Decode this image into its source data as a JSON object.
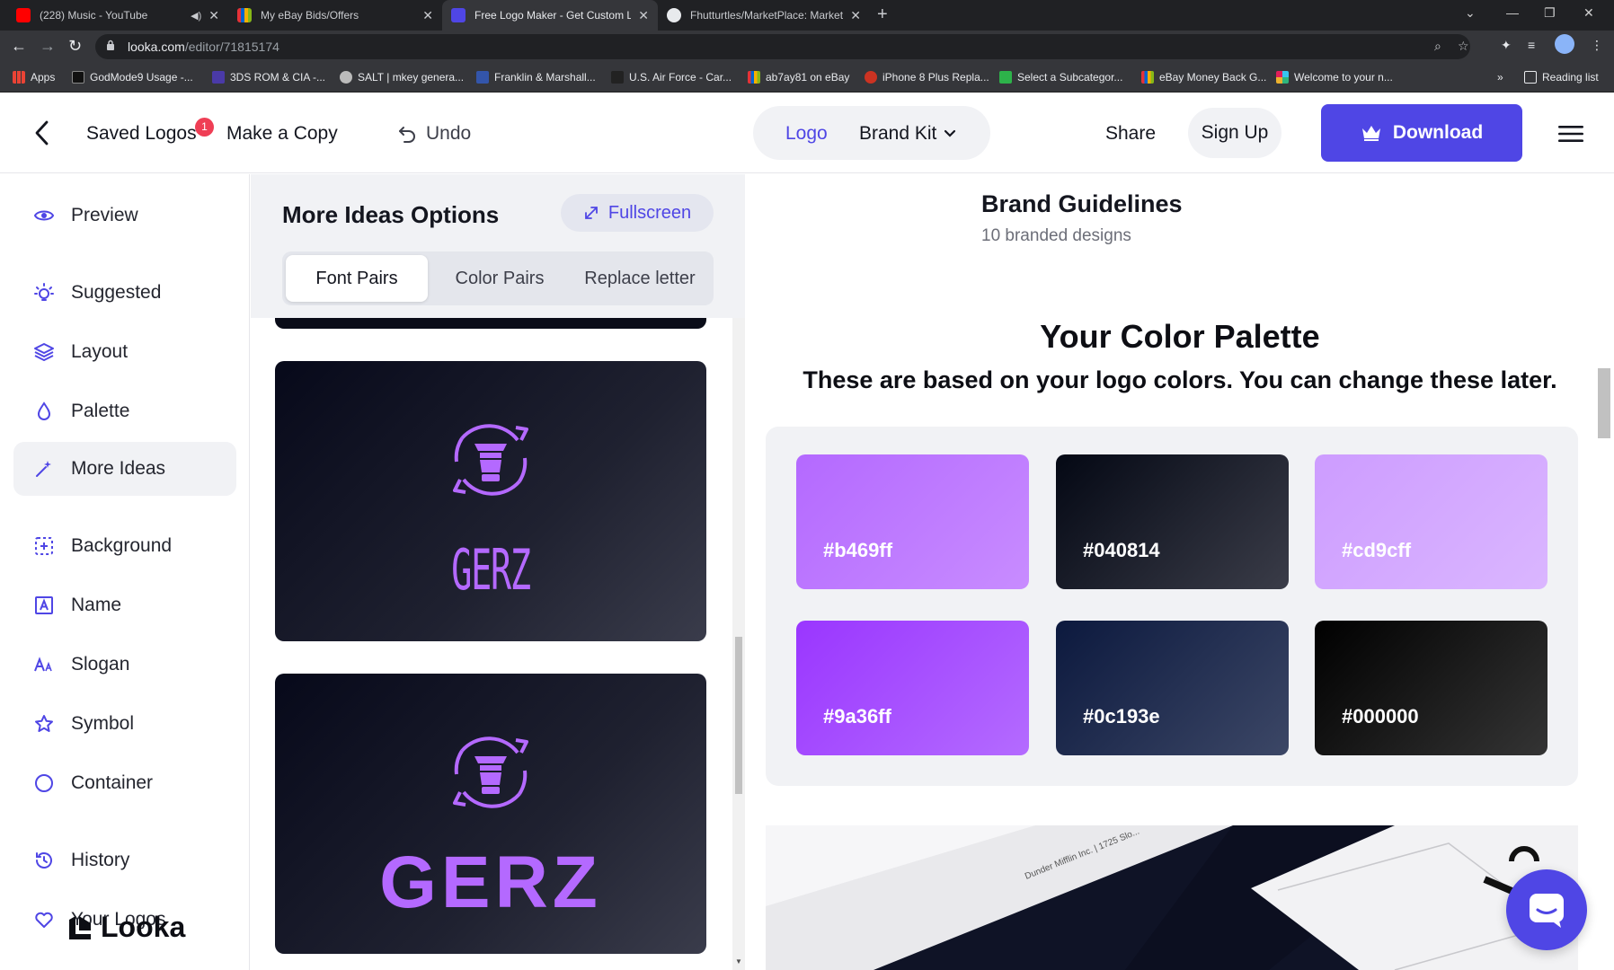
{
  "browser": {
    "tabs": [
      {
        "title": "(228) Music - YouTube",
        "active": false
      },
      {
        "title": "My eBay Bids/Offers",
        "active": false
      },
      {
        "title": "Free Logo Maker - Get Custom L",
        "active": true
      },
      {
        "title": "Fhutturtles/MarketPlace: Market",
        "active": false
      }
    ],
    "url_host": "looka.com",
    "url_path": "/editor/71815174",
    "bookmarks": [
      "Apps",
      "GodMode9 Usage -...",
      "3DS ROM & CIA -...",
      "SALT | mkey genera...",
      "Franklin & Marshall...",
      "U.S. Air Force - Car...",
      "ab7ay81 on eBay",
      "iPhone 8 Plus Repla...",
      "Select a Subcategor...",
      "eBay Money Back G...",
      "Welcome to your n..."
    ],
    "reading_list": "Reading list"
  },
  "header": {
    "saved_logos": "Saved Logos",
    "saved_badge": "1",
    "make_copy": "Make a Copy",
    "undo": "Undo",
    "logo_tab": "Logo",
    "brand_kit": "Brand Kit",
    "share": "Share",
    "sign_up": "Sign Up",
    "download": "Download"
  },
  "sidebar": {
    "items": [
      {
        "label": "Preview",
        "icon": "eye-icon"
      },
      {
        "label": "Suggested",
        "icon": "lightbulb-icon"
      },
      {
        "label": "Layout",
        "icon": "layers-icon"
      },
      {
        "label": "Palette",
        "icon": "droplet-icon"
      },
      {
        "label": "More Ideas",
        "icon": "magic-wand-icon"
      },
      {
        "label": "Background",
        "icon": "background-icon"
      },
      {
        "label": "Name",
        "icon": "name-icon"
      },
      {
        "label": "Slogan",
        "icon": "slogan-icon"
      },
      {
        "label": "Symbol",
        "icon": "star-icon"
      },
      {
        "label": "Container",
        "icon": "circle-icon"
      },
      {
        "label": "History",
        "icon": "history-icon"
      },
      {
        "label": "Your Logos",
        "icon": "heart-icon"
      }
    ],
    "brand": "Looka"
  },
  "options": {
    "title": "More Ideas Options",
    "fullscreen": "Fullscreen",
    "tabs": [
      "Font Pairs",
      "Color Pairs",
      "Replace letter"
    ],
    "cards": [
      {
        "wordmark": "GERZ",
        "style": "condensed"
      },
      {
        "wordmark": "GERZ",
        "style": "bold"
      }
    ]
  },
  "main": {
    "guidelines_title": "Brand Guidelines",
    "guidelines_sub": "10 branded designs",
    "palette_title": "Your Color Palette",
    "palette_sub": "These are based on your logo colors. You can change these later.",
    "swatches": [
      {
        "label": "#b469ff",
        "color": "#b469ff"
      },
      {
        "label": "#040814",
        "color": "#040814"
      },
      {
        "label": "#cd9cff",
        "color": "#cd9cff"
      },
      {
        "label": "#9a36ff",
        "color": "#9a36ff"
      },
      {
        "label": "#0c193e",
        "color": "#0c193e"
      },
      {
        "label": "#000000",
        "color": "#000000"
      }
    ],
    "mockup_text": "Dunder Mifflin Inc. | 1725 Slo..."
  },
  "colors": {
    "accent": "#4f46e5",
    "logo_purple": "#b469ff",
    "badge_red": "#ef3e55"
  }
}
